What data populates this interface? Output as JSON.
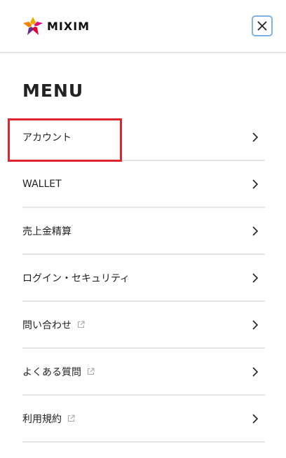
{
  "brand": {
    "name": "MIXIM"
  },
  "close_button": {
    "icon": "close-icon"
  },
  "menu": {
    "title": "MENU",
    "items": [
      {
        "label": "アカウント",
        "external": false
      },
      {
        "label": "WALLET",
        "external": false
      },
      {
        "label": "売上金精算",
        "external": false
      },
      {
        "label": "ログイン・セキュリティ",
        "external": false
      },
      {
        "label": "問い合わせ",
        "external": true
      },
      {
        "label": "よくある質問",
        "external": true
      },
      {
        "label": "利用規約",
        "external": true
      }
    ]
  },
  "colors": {
    "highlight": "#e1232b",
    "focus_ring": "#7fb3e6",
    "divider": "#e5e5e5"
  }
}
